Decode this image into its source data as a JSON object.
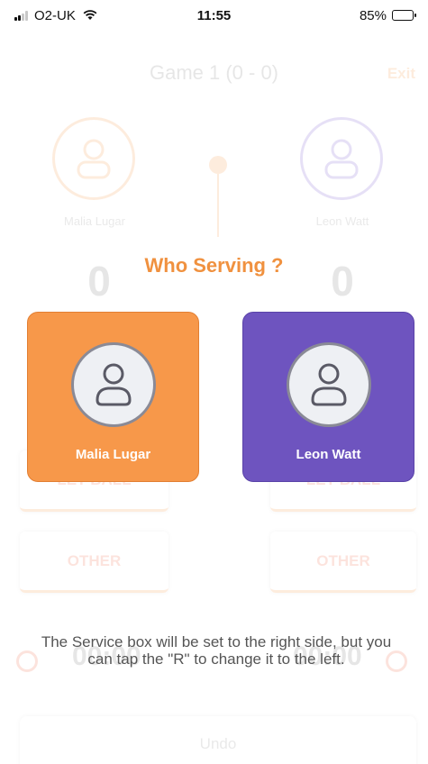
{
  "status_bar": {
    "carrier": "O2-UK",
    "time": "11:55",
    "battery": "85%",
    "battery_level": 0.85
  },
  "background": {
    "game_title": "Game 1 (0 - 0)",
    "exit_label": "Exit",
    "players": [
      {
        "name": "Malia Lugar",
        "score": "0",
        "box1": "LET BALL",
        "box2": "OTHER",
        "timer": "00:00"
      },
      {
        "name": "Leon Watt",
        "score": "0",
        "box1": "LET BALL",
        "box2": "OTHER",
        "timer": "00:00"
      }
    ],
    "undo_label": "Undo"
  },
  "modal": {
    "title": "Who Serving ?",
    "cards": [
      {
        "name": "Malia Lugar",
        "color": "#f7984a",
        "icon": "user-icon"
      },
      {
        "name": "Leon Watt",
        "color": "#6e54bf",
        "icon": "user-icon"
      }
    ],
    "info": "The Service box will be set to the right side, but you can tap the \"R\" to change it to the left."
  },
  "colors": {
    "accent_orange": "#f7984a",
    "accent_purple": "#6e54bf",
    "title_orange": "#f0913f"
  }
}
